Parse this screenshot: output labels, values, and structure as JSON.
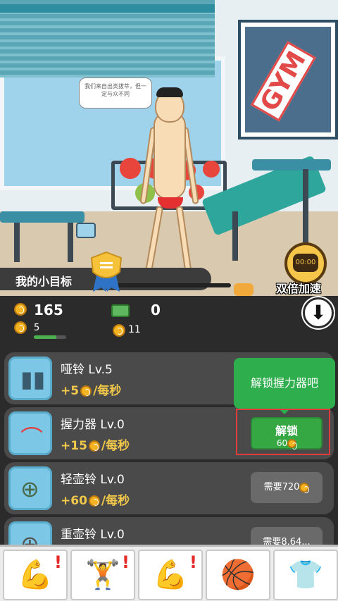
{
  "scene": {
    "speech_bubble": "我们来自出类拔萃，但一定与众不同",
    "poster_text": "GYM",
    "goal_label": "我的小目标",
    "goal_progress": 0.65,
    "speed_timer": "00:00",
    "speed_label": "双倍加速"
  },
  "stats": {
    "coins": "165",
    "level": "5",
    "level_progress": 0.7,
    "cash": "0",
    "points": "11"
  },
  "items": [
    {
      "name": "哑铃  Lv.5",
      "rate_prefix": "+5",
      "rate_unit": "/每秒",
      "icon": "dumbbell-icon",
      "glyph": "▮▮"
    },
    {
      "name": "握力器  Lv.0",
      "rate_prefix": "+15",
      "rate_unit": "/每秒",
      "icon": "hand-gripper-icon",
      "glyph": "⌒"
    },
    {
      "name": "轻壶铃  Lv.0",
      "rate_prefix": "+60",
      "rate_unit": "/每秒",
      "icon": "kettlebell-icon",
      "glyph": "⊕",
      "requirement": "需要720"
    },
    {
      "name": "重壶铃  Lv.0",
      "rate_prefix": "",
      "rate_unit": "",
      "icon": "heavy-kettlebell-icon",
      "glyph": "⊕",
      "requirement": "需要8.64..."
    }
  ],
  "unlock": {
    "label": "解锁",
    "cost": "60"
  },
  "tooltip": "解锁握力器吧",
  "tabs": [
    {
      "name": "tab-training",
      "glyph": "💪",
      "alert": "!"
    },
    {
      "name": "tab-equipment",
      "glyph": "🏋",
      "alert": "!"
    },
    {
      "name": "tab-muscle",
      "glyph": "💪",
      "alert": "!"
    },
    {
      "name": "tab-sports",
      "glyph": "🏀",
      "alert": ""
    },
    {
      "name": "tab-outfit",
      "glyph": "👕",
      "alert": ""
    }
  ],
  "colors": {
    "accent_green": "#35a843",
    "coin_gold": "#f5b321",
    "highlight_red": "#e03b3b"
  }
}
